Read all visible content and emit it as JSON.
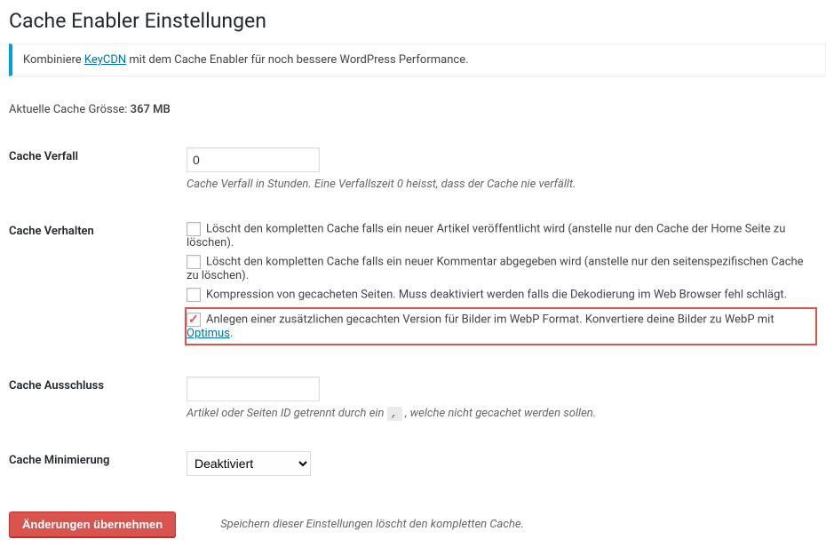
{
  "title": "Cache Enabler Einstellungen",
  "notice": {
    "pre": "Kombiniere ",
    "link_text": "KeyCDN",
    "post": " mit dem Cache Enabler für noch bessere WordPress Performance."
  },
  "cache_size": {
    "label": "Aktuelle Cache Grösse: ",
    "value": "367 MB"
  },
  "fields": {
    "expiry": {
      "label": "Cache Verfall",
      "value": "0",
      "description": "Cache Verfall in Stunden. Eine Verfallszeit 0 heisst, dass der Cache nie verfällt."
    },
    "behavior": {
      "label": "Cache Verhalten",
      "options": [
        {
          "checked": false,
          "text": "Löscht den kompletten Cache falls ein neuer Artikel veröffentlicht wird (anstelle nur den Cache der Home Seite zu löschen)."
        },
        {
          "checked": false,
          "text": "Löscht den kompletten Cache falls ein neuer Kommentar abgegeben wird (anstelle nur den seitenspezifischen Cache zu löschen)."
        },
        {
          "checked": false,
          "text": "Kompression von gecacheten Seiten. Muss deaktiviert werden falls die Dekodierung im Web Browser fehl schlägt."
        },
        {
          "checked": true,
          "text_pre": "Anlegen einer zusätzlichen gecachten Version für Bilder im WebP Format. Konvertiere deine Bilder zu WebP mit ",
          "link": "Optimus",
          "text_post": "."
        }
      ]
    },
    "exclusion": {
      "label": "Cache Ausschluss",
      "value": "",
      "description_pre": "Artikel oder Seiten ID getrennt durch ein ",
      "code": ",",
      "description_post": " , welche nicht gecachet werden sollen."
    },
    "minify": {
      "label": "Cache Minimierung",
      "selected": "Deaktiviert"
    }
  },
  "submit": {
    "button": "Änderungen übernehmen",
    "note": "Speichern dieser Einstellungen löscht den kompletten Cache."
  }
}
